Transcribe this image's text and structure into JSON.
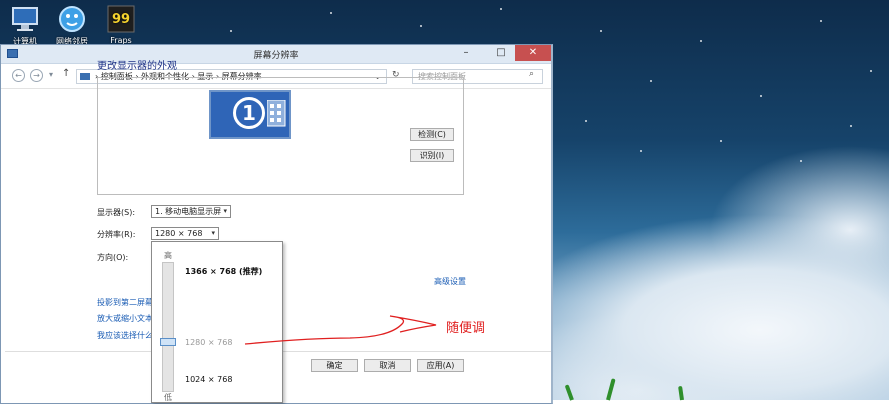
{
  "desktop": {
    "icons": [
      {
        "name": "computer-icon",
        "label": "计算机"
      },
      {
        "name": "network-icon",
        "label": "网络邻居"
      },
      {
        "name": "app-99-icon",
        "label": "Fraps"
      }
    ]
  },
  "window": {
    "title": "屏幕分辨率",
    "buttons": {
      "minimize": "–",
      "maximize": "□",
      "close": "✕"
    }
  },
  "address": {
    "back_icon": "back-arrow-icon",
    "forward_icon": "forward-arrow-icon",
    "up_icon": "up-arrow-icon",
    "crumbs": "› 控制面板 › 外观和个性化 › 显示 › 屏幕分辨率",
    "refresh_icon": "refresh-icon",
    "search_placeholder": "搜索控制面板"
  },
  "main": {
    "heading": "更改显示器的外观",
    "monitor_number": "1",
    "detect_button": "检测(C)",
    "identify_button": "识别(I)",
    "display_label": "显示器(S):",
    "display_value": "1. 移动电脑显示屏",
    "resolution_label": "分辨率(R):",
    "resolution_value": "1280 × 768",
    "orientation_label": "方向(O):",
    "advanced_link": "高级设置",
    "links": [
      "投影到第二屏幕",
      "放大或缩小文本",
      "我应该选择什么"
    ]
  },
  "dropdown": {
    "high_label": "高",
    "low_label": "低",
    "option_recommended": "1366 × 768 (推荐)",
    "option_current": "1280 × 768",
    "option_low": "1024 × 768"
  },
  "footer": {
    "ok": "确定",
    "cancel": "取消",
    "apply": "应用(A)"
  },
  "annotation": {
    "text": "随便调",
    "color": "#e02020"
  },
  "colors": {
    "accent": "#2f65b7",
    "link": "#1a5cb4",
    "heading": "#1e3287"
  }
}
